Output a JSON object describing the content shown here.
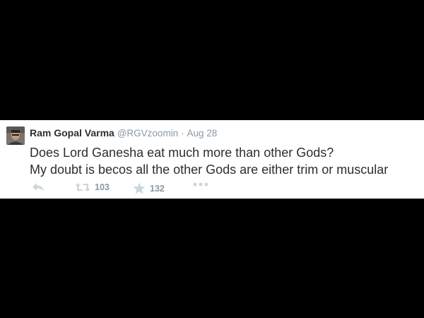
{
  "tweet": {
    "author_name": "Ram Gopal Varma",
    "handle": "@RGVzoomin",
    "separator": "·",
    "time": "Aug 28",
    "lines": [
      "Does Lord Ganesha eat much more than other Gods?",
      "My doubt is becos all the other Gods are either trim or muscular"
    ]
  },
  "actions": {
    "reply_icon": "reply-icon",
    "retweet_icon": "retweet-icon",
    "retweet_count": "103",
    "favorite_icon": "star-icon",
    "favorite_count": "132",
    "more_icon": "more-icon"
  },
  "colors": {
    "background": "#000000",
    "card": "#ffffff",
    "text": "#292f33",
    "secondary": "#8899a6",
    "icon": "#ccd6dd"
  }
}
